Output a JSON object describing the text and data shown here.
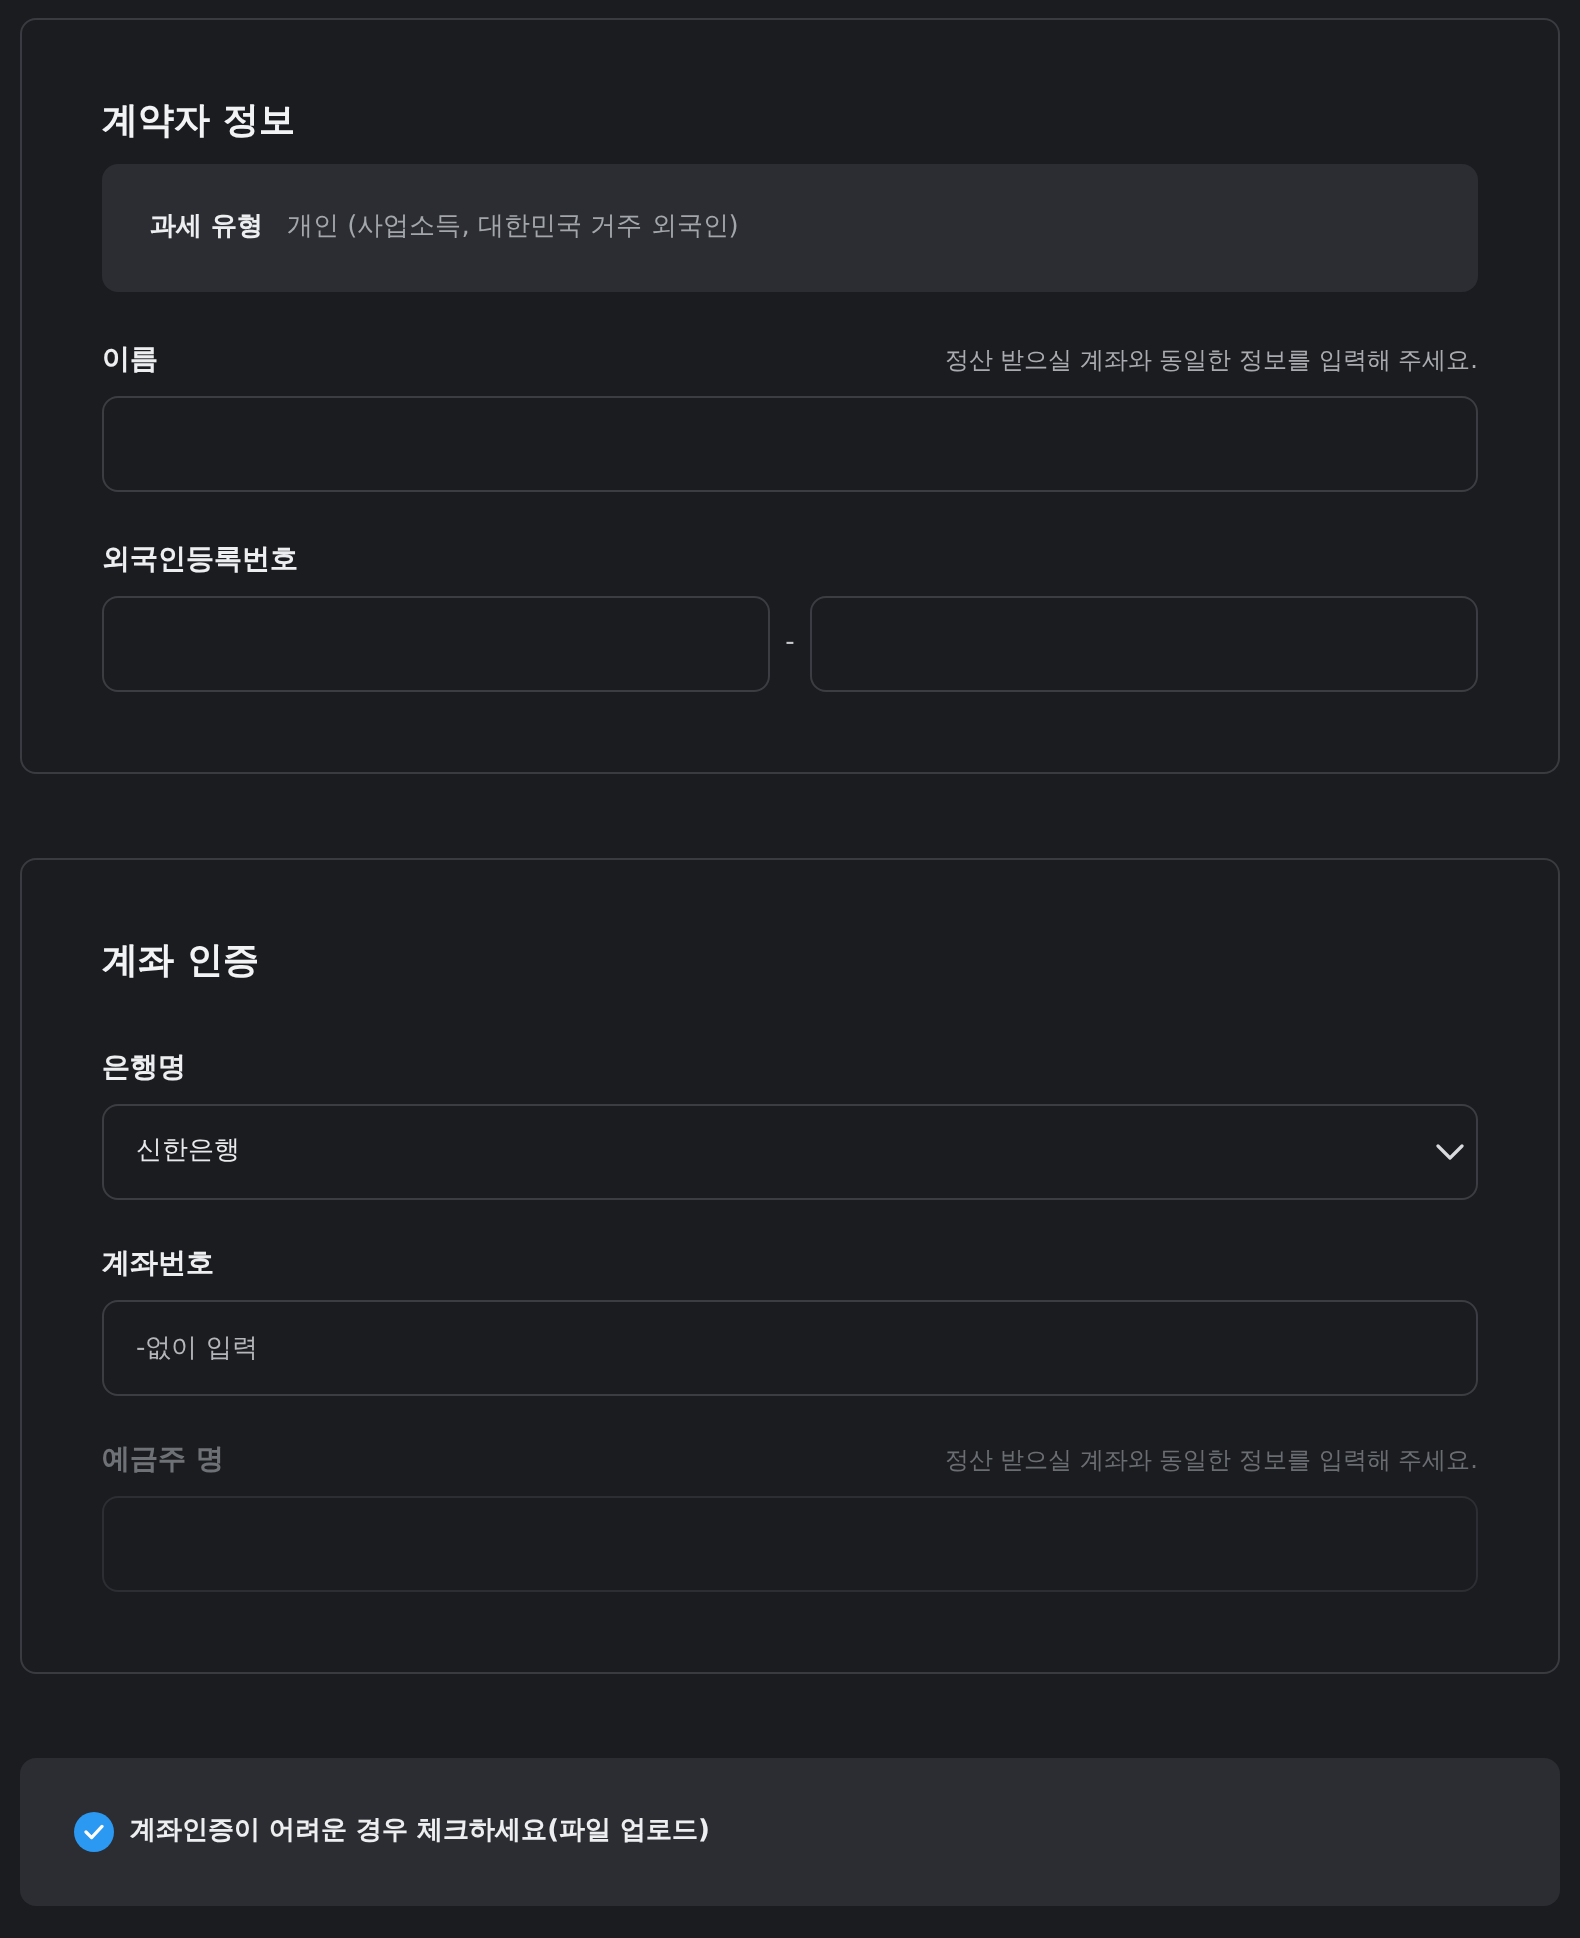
{
  "sections": [
    {
      "title": "계약자 정보",
      "tax_type": {
        "label": "과세 유형",
        "value": "개인 (사업소득, 대한민국 거주 외국인)"
      },
      "fields": [
        {
          "kind": "text",
          "label": "이름",
          "hint": "정산 받으실 계좌와 동일한 정보를 입력해 주세요.",
          "disabled": false
        },
        {
          "kind": "split",
          "label": "외국인등록번호",
          "separator": "-",
          "disabled": false
        }
      ]
    },
    {
      "title": "계좌 인증",
      "fields": [
        {
          "kind": "select",
          "label": "은행명",
          "value": "신한은행",
          "disabled": false
        },
        {
          "kind": "text",
          "label": "계좌번호",
          "placeholder": "-없이 입력",
          "disabled": false
        },
        {
          "kind": "text",
          "label": "예금주 명",
          "hint": "정산 받으실 계좌와 동일한 정보를 입력해 주세요.",
          "disabled": true
        }
      ]
    }
  ],
  "upload_option": {
    "label": "계좌인증이 어려운 경우 체크하세요(파일 업로드)",
    "checked": true
  }
}
